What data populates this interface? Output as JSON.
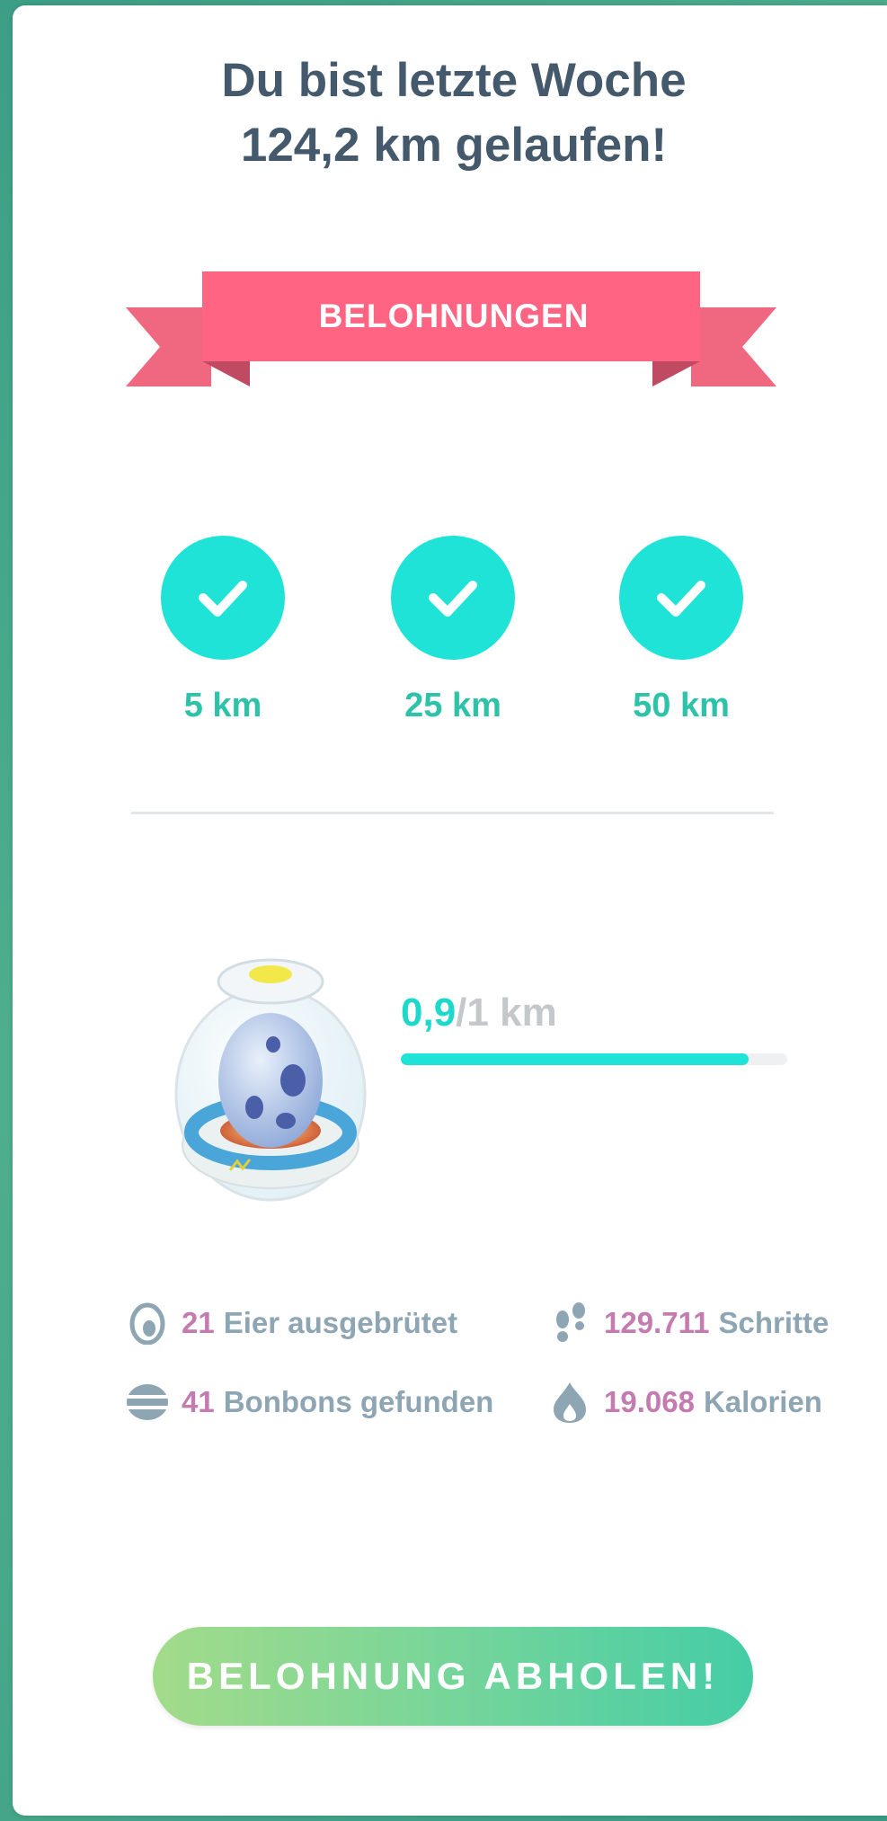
{
  "header": {
    "title": "Du bist letzte Woche 124,2 km gelaufen!"
  },
  "banner": {
    "label": "BELOHNUNGEN"
  },
  "milestones": [
    {
      "label": "5 km",
      "completed": true
    },
    {
      "label": "25 km",
      "completed": true
    },
    {
      "label": "50 km",
      "completed": true
    }
  ],
  "incubator": {
    "progress_current": "0,9",
    "progress_total": "/1 km",
    "progress_fraction": 0.9
  },
  "stats": {
    "eggs": {
      "value": "21",
      "label": "Eier ausgebrütet",
      "icon": "egg-icon"
    },
    "steps": {
      "value": "129.711",
      "label": "Schritte",
      "icon": "footprints-icon"
    },
    "candy": {
      "value": "41",
      "label": "Bonbons gefunden",
      "icon": "candy-icon"
    },
    "calories": {
      "value": "19.068",
      "label": "Kalorien",
      "icon": "flame-icon"
    }
  },
  "action": {
    "claim_label": "BELOHNUNG ABHOLEN!"
  },
  "colors": {
    "accent_teal": "#1ee3d6",
    "ribbon_pink": "#ff6482",
    "stat_number": "#c47bb0",
    "title": "#44596b"
  }
}
